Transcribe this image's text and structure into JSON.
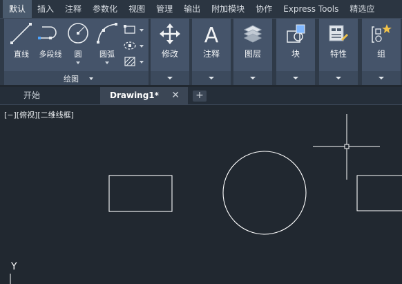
{
  "ribbon_tabs": [
    "默认",
    "插入",
    "注释",
    "参数化",
    "视图",
    "管理",
    "输出",
    "附加模块",
    "协作",
    "Express Tools",
    "精选应"
  ],
  "draw_group": {
    "tools": [
      {
        "label": "直线",
        "icon": "line-icon"
      },
      {
        "label": "多段线",
        "icon": "polyline-icon"
      },
      {
        "label": "圆",
        "icon": "circle-icon"
      },
      {
        "label": "圆弧",
        "icon": "arc-icon"
      }
    ],
    "small_tools": [
      "rectangle-icon",
      "ellipse-icon",
      "hatch-icon"
    ],
    "title": "绘图"
  },
  "panels": [
    {
      "label": "修改",
      "icon": "move-icon"
    },
    {
      "label": "注释",
      "icon": "text-icon"
    },
    {
      "label": "图层",
      "icon": "layers-icon"
    },
    {
      "label": "块",
      "icon": "block-icon"
    },
    {
      "label": "特性",
      "icon": "properties-icon"
    },
    {
      "label": "组",
      "icon": "group-icon"
    }
  ],
  "file_tabs": {
    "start": "开始",
    "drawing": "Drawing1*",
    "close": "✕",
    "new": "+"
  },
  "viewport_label": "[−][俯视][二维线框]",
  "ucs_label": "Y",
  "colors": {
    "canvas_bg": "#212830",
    "ribbon_panel": "#45546a",
    "active_tab": "#4a5a6d",
    "linework": "#ffffff"
  }
}
